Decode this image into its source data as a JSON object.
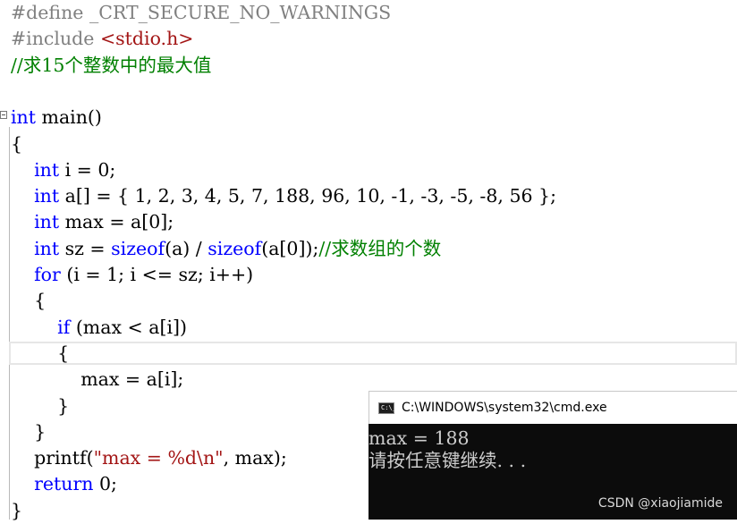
{
  "editor": {
    "lines": [
      {
        "parts": [
          {
            "t": "#define _CRT_SECURE_NO_WARNINGS",
            "c": "pp"
          }
        ]
      },
      {
        "parts": [
          {
            "t": "#include ",
            "c": "pp"
          },
          {
            "t": "<stdio.h>",
            "c": "inc"
          }
        ]
      },
      {
        "parts": [
          {
            "t": "//求15个整数中的最大值",
            "c": "cmt"
          }
        ]
      },
      {
        "parts": []
      },
      {
        "parts": [
          {
            "t": "int",
            "c": "kw"
          },
          {
            "t": " main()",
            "c": ""
          }
        ]
      },
      {
        "parts": [
          {
            "t": "{",
            "c": ""
          }
        ]
      },
      {
        "parts": [
          {
            "t": "    ",
            "c": ""
          },
          {
            "t": "int",
            "c": "kw"
          },
          {
            "t": " i = 0;",
            "c": ""
          }
        ]
      },
      {
        "parts": [
          {
            "t": "    ",
            "c": ""
          },
          {
            "t": "int",
            "c": "kw"
          },
          {
            "t": " a[] = { 1, 2, 3, 4, 5, 7, 188, 96, 10, -1, -3, -5, -8, 56 };",
            "c": ""
          }
        ]
      },
      {
        "parts": [
          {
            "t": "    ",
            "c": ""
          },
          {
            "t": "int",
            "c": "kw"
          },
          {
            "t": " max = a[0];",
            "c": ""
          }
        ]
      },
      {
        "parts": [
          {
            "t": "    ",
            "c": ""
          },
          {
            "t": "int",
            "c": "kw"
          },
          {
            "t": " sz = ",
            "c": ""
          },
          {
            "t": "sizeof",
            "c": "kw"
          },
          {
            "t": "(a) / ",
            "c": ""
          },
          {
            "t": "sizeof",
            "c": "kw"
          },
          {
            "t": "(a[0]);",
            "c": ""
          },
          {
            "t": "//求数组的个数",
            "c": "cmt"
          }
        ]
      },
      {
        "parts": [
          {
            "t": "    ",
            "c": ""
          },
          {
            "t": "for",
            "c": "kw"
          },
          {
            "t": " (i = 1; i <= sz; i++)",
            "c": ""
          }
        ]
      },
      {
        "parts": [
          {
            "t": "    {",
            "c": ""
          }
        ]
      },
      {
        "parts": [
          {
            "t": "        ",
            "c": ""
          },
          {
            "t": "if",
            "c": "kw"
          },
          {
            "t": " (max < a[i])",
            "c": ""
          }
        ]
      },
      {
        "parts": [
          {
            "t": "        {",
            "c": ""
          }
        ]
      },
      {
        "parts": [
          {
            "t": "            max = a[i];",
            "c": ""
          }
        ]
      },
      {
        "parts": [
          {
            "t": "        }",
            "c": ""
          }
        ]
      },
      {
        "parts": [
          {
            "t": "    }",
            "c": ""
          }
        ]
      },
      {
        "parts": [
          {
            "t": "    printf(",
            "c": ""
          },
          {
            "t": "\"max = %d\\n\"",
            "c": "str"
          },
          {
            "t": ", max);",
            "c": ""
          }
        ]
      },
      {
        "parts": [
          {
            "t": "    ",
            "c": ""
          },
          {
            "t": "return",
            "c": "kw"
          },
          {
            "t": " 0;",
            "c": ""
          }
        ]
      },
      {
        "parts": [
          {
            "t": "}",
            "c": ""
          }
        ]
      }
    ]
  },
  "console": {
    "title": "C:\\WINDOWS\\system32\\cmd.exe",
    "icon": "cmd-icon",
    "icon_text": "C:\\_",
    "output": [
      "max = 188",
      "请按任意键继续. . ."
    ]
  },
  "watermark": "CSDN @xiaojiamide",
  "colors": {
    "keyword": "#0000ff",
    "preprocessor": "#808080",
    "include": "#a31515",
    "comment": "#008000",
    "string": "#a31515",
    "console_bg": "#0c0c0c",
    "console_text": "#cccccc"
  }
}
